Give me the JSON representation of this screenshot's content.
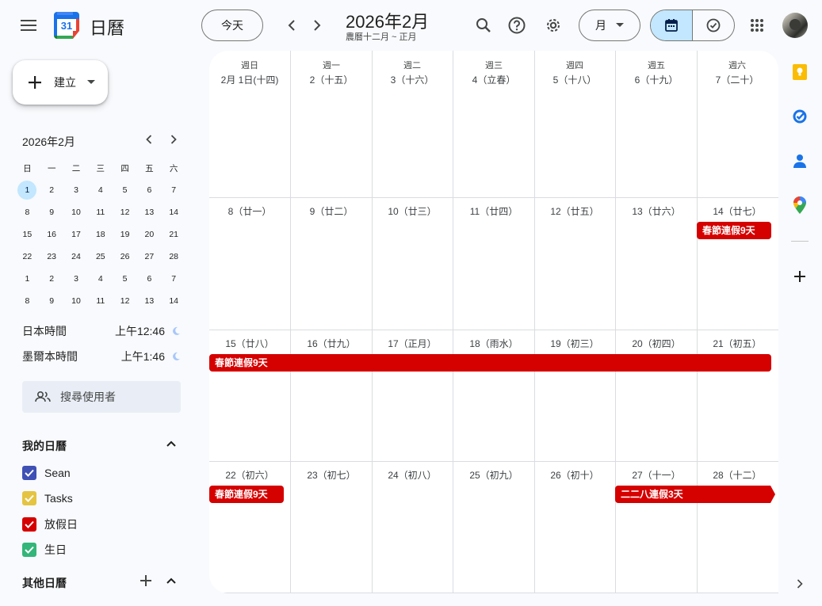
{
  "app": {
    "title": "日曆",
    "logo_day": "31"
  },
  "header": {
    "today_label": "今天",
    "month_title": "2026年2月",
    "lunar_subtitle": "農曆十二月 ~ 正月",
    "view_label": "月"
  },
  "sidebar": {
    "create_label": "建立",
    "mini_title": "2026年2月",
    "weekdays": [
      "日",
      "一",
      "二",
      "三",
      "四",
      "五",
      "六"
    ],
    "mini_rows": [
      [
        "1",
        "2",
        "3",
        "4",
        "5",
        "6",
        "7"
      ],
      [
        "8",
        "9",
        "10",
        "11",
        "12",
        "13",
        "14"
      ],
      [
        "15",
        "16",
        "17",
        "18",
        "19",
        "20",
        "21"
      ],
      [
        "22",
        "23",
        "24",
        "25",
        "26",
        "27",
        "28"
      ],
      [
        "1",
        "2",
        "3",
        "4",
        "5",
        "6",
        "7"
      ],
      [
        "8",
        "9",
        "10",
        "11",
        "12",
        "13",
        "14"
      ]
    ],
    "timezones": [
      {
        "name": "日本時間",
        "time": "上午12:46"
      },
      {
        "name": "墨爾本時間",
        "time": "上午1:46"
      }
    ],
    "search_people": "搜尋使用者",
    "my_calendars_title": "我的日曆",
    "my_calendars": [
      {
        "name": "Sean",
        "color": "#3f51b5"
      },
      {
        "name": "Tasks",
        "color": "#e4c441"
      },
      {
        "name": "放假日",
        "color": "#d50000"
      },
      {
        "name": "生日",
        "color": "#33b679"
      }
    ],
    "other_calendars_title": "其他日曆"
  },
  "grid": {
    "weekdays": [
      "週日",
      "週一",
      "週二",
      "週三",
      "週四",
      "週五",
      "週六"
    ],
    "weeks": [
      [
        "2月 1日(十四)",
        "2（十五）",
        "3（十六）",
        "4（立春）",
        "5（十八）",
        "6（十九）",
        "7（二十）"
      ],
      [
        "8（廿一）",
        "9（廿二）",
        "10（廿三）",
        "11（廿四）",
        "12（廿五）",
        "13（廿六）",
        "14（廿七）"
      ],
      [
        "15（廿八）",
        "16（廿九）",
        "17（正月）",
        "18（雨水）",
        "19（初三）",
        "20（初四）",
        "21（初五）"
      ],
      [
        "22（初六）",
        "23（初七）",
        "24（初八）",
        "25（初九）",
        "26（初十）",
        "27（十一）",
        "28（十二）"
      ]
    ],
    "events": [
      {
        "title": "春節連假9天",
        "color": "#d50000"
      },
      {
        "title": "春節連假9天",
        "color": "#d50000"
      },
      {
        "title": "春節連假9天",
        "color": "#d50000"
      },
      {
        "title": "二二八連假3天",
        "color": "#d50000"
      }
    ]
  }
}
